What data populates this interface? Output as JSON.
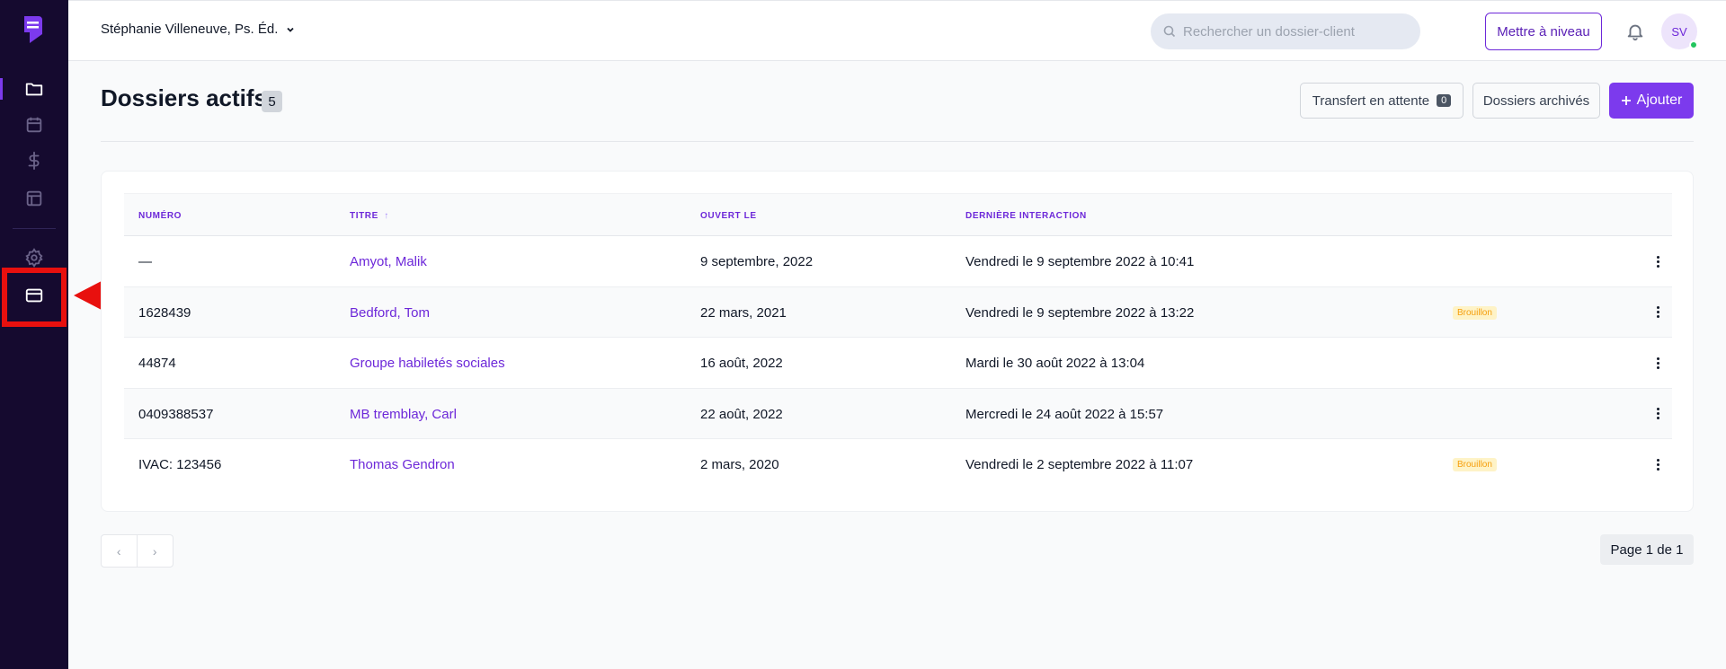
{
  "header": {
    "user_name": "Stéphanie Villeneuve, Ps. Éd.",
    "search_placeholder": "Rechercher un dossier-client",
    "upgrade_label": "Mettre à niveau",
    "avatar_initials": "SV"
  },
  "page": {
    "title": "Dossiers actifs",
    "count": "5",
    "transfer_label": "Transfert en attente",
    "transfer_count": "0",
    "archived_label": "Dossiers archivés",
    "add_label": "Ajouter"
  },
  "table": {
    "headers": {
      "number": "NUMÉRO",
      "title": "TITRE",
      "sort_indicator": "↑",
      "opened": "OUVERT LE",
      "last": "DERNIÈRE INTERACTION"
    },
    "rows": [
      {
        "number": "—",
        "title": "Amyot, Malik",
        "opened": "9 septembre, 2022",
        "last": "Vendredi le 9 septembre 2022 à 10:41",
        "badge": ""
      },
      {
        "number": "1628439",
        "title": "Bedford, Tom",
        "opened": "22 mars, 2021",
        "last": "Vendredi le 9 septembre 2022 à 13:22",
        "badge": "Brouillon"
      },
      {
        "number": "44874",
        "title": "Groupe habiletés sociales",
        "opened": "16 août, 2022",
        "last": "Mardi le 30 août 2022 à 13:04",
        "badge": ""
      },
      {
        "number": "0409388537",
        "title": "MB tremblay, Carl",
        "opened": "22 août, 2022",
        "last": "Mercredi le 24 août 2022 à 15:57",
        "badge": ""
      },
      {
        "number": "IVAC: 123456",
        "title": "Thomas Gendron",
        "opened": "2 mars, 2020",
        "last": "Vendredi le 2 septembre 2022 à 11:07",
        "badge": "Brouillon"
      }
    ]
  },
  "pagination": {
    "prev": "‹",
    "next": "›",
    "info": "Page 1 de 1"
  },
  "colors": {
    "sidebar": "#150a2f",
    "accent": "#7c3aed",
    "highlight": "#e8100e"
  }
}
